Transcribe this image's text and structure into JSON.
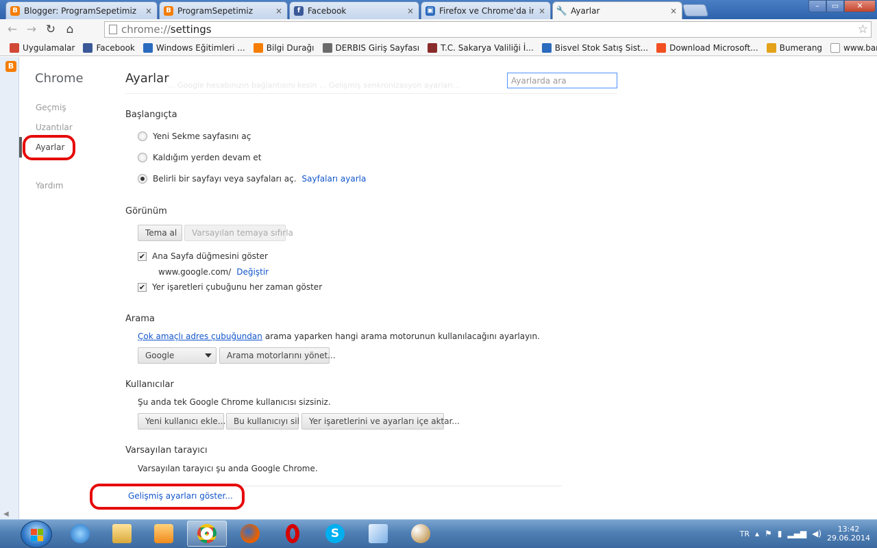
{
  "tabs": [
    {
      "title": "Blogger: ProgramSepetimiz",
      "icon": "blogger-icon"
    },
    {
      "title": "ProgramSepetimiz",
      "icon": "blogger-icon"
    },
    {
      "title": "Facebook",
      "icon": "facebook-icon"
    },
    {
      "title": "Firefox ve Chrome'da indirme",
      "icon": "firefox-icon"
    },
    {
      "title": "Ayarlar",
      "icon": "wrench-icon"
    }
  ],
  "tab_close_glyph": "×",
  "window": {
    "minimize": "–",
    "maximize": "▭",
    "close": "✕"
  },
  "toolbar": {
    "back": "←",
    "forward": "→",
    "reload": "↻",
    "home": "⌂",
    "url_scheme": "chrome://",
    "url_path": "settings",
    "star": "☆"
  },
  "bookmarks": [
    {
      "label": "Uygulamalar",
      "color": "#d14836"
    },
    {
      "label": "Facebook",
      "color": "#3b5998"
    },
    {
      "label": "Windows Eğitimleri ...",
      "color": "#2a6bbd"
    },
    {
      "label": "Bilgi Durağı",
      "color": "#f57d00"
    },
    {
      "label": "DERBIS Giriş Sayfası",
      "color": "#6b6b6b"
    },
    {
      "label": "T.C. Sakarya Valiliği İ...",
      "color": "#8a2b2b"
    },
    {
      "label": "Bisvel Stok Satış Sist...",
      "color": "#2a6bbd"
    },
    {
      "label": "Download Microsoft...",
      "color": "#f25022"
    },
    {
      "label": "Bumerang",
      "color": "#e3a21a"
    },
    {
      "label": "www.barkodokuyuc...",
      "color": "#ffffff"
    }
  ],
  "nav": {
    "title": "Chrome",
    "history": "Geçmiş",
    "extensions": "Uzantılar",
    "settings": "Ayarlar",
    "help": "Yardım"
  },
  "settings": {
    "title": "Ayarlar",
    "search_placeholder": "Ayarlarda ara",
    "ghost_text": "... Google hesabınızın bağlantısını kesin ...   Gelişmiş senkronizasyon ayarları...",
    "startup": {
      "heading": "Başlangıçta",
      "opt_newtab": "Yeni Sekme sayfasını aç",
      "opt_continue": "Kaldığım yerden devam et",
      "opt_pages": "Belirli bir sayfayı veya sayfaları aç.",
      "set_pages_link": "Sayfaları ayarla"
    },
    "appearance": {
      "heading": "Görünüm",
      "get_theme": "Tema al",
      "reset_theme": "Varsayılan temaya sıfırla",
      "show_home": "Ana Sayfa düğmesini göster",
      "home_url": "www.google.com/",
      "change_link": "Değiştir",
      "show_bookmarks": "Yer işaretleri çubuğunu her zaman göster"
    },
    "search": {
      "heading": "Arama",
      "omnibox_link": "Çok amaçlı adres çubuğundan",
      "desc": "arama yaparken hangi arama motorunun kullanılacağını ayarlayın.",
      "engine": "Google",
      "manage": "Arama motorlarını yönet..."
    },
    "users": {
      "heading": "Kullanıcılar",
      "desc": "Şu anda tek Google Chrome kullanıcısı sizsiniz.",
      "add": "Yeni kullanıcı ekle...",
      "delete": "Bu kullanıcıyı sil",
      "import": "Yer işaretlerini ve ayarları içe aktar..."
    },
    "default_browser": {
      "heading": "Varsayılan tarayıcı",
      "desc": "Varsayılan tarayıcı şu anda Google Chrome."
    },
    "advanced_link": "Gelişmiş ayarları göster..."
  },
  "colors": {
    "annotation": "#e60a0a",
    "link": "#1155cc"
  },
  "taskbar": {
    "apps": [
      "ie-icon",
      "explorer-icon",
      "media-player-icon",
      "chrome-icon",
      "firefox-icon",
      "opera-icon",
      "skype-icon",
      "notepad-icon",
      "paint-icon"
    ],
    "language": "TR",
    "time": "13:42",
    "date": "29.06.2014"
  }
}
